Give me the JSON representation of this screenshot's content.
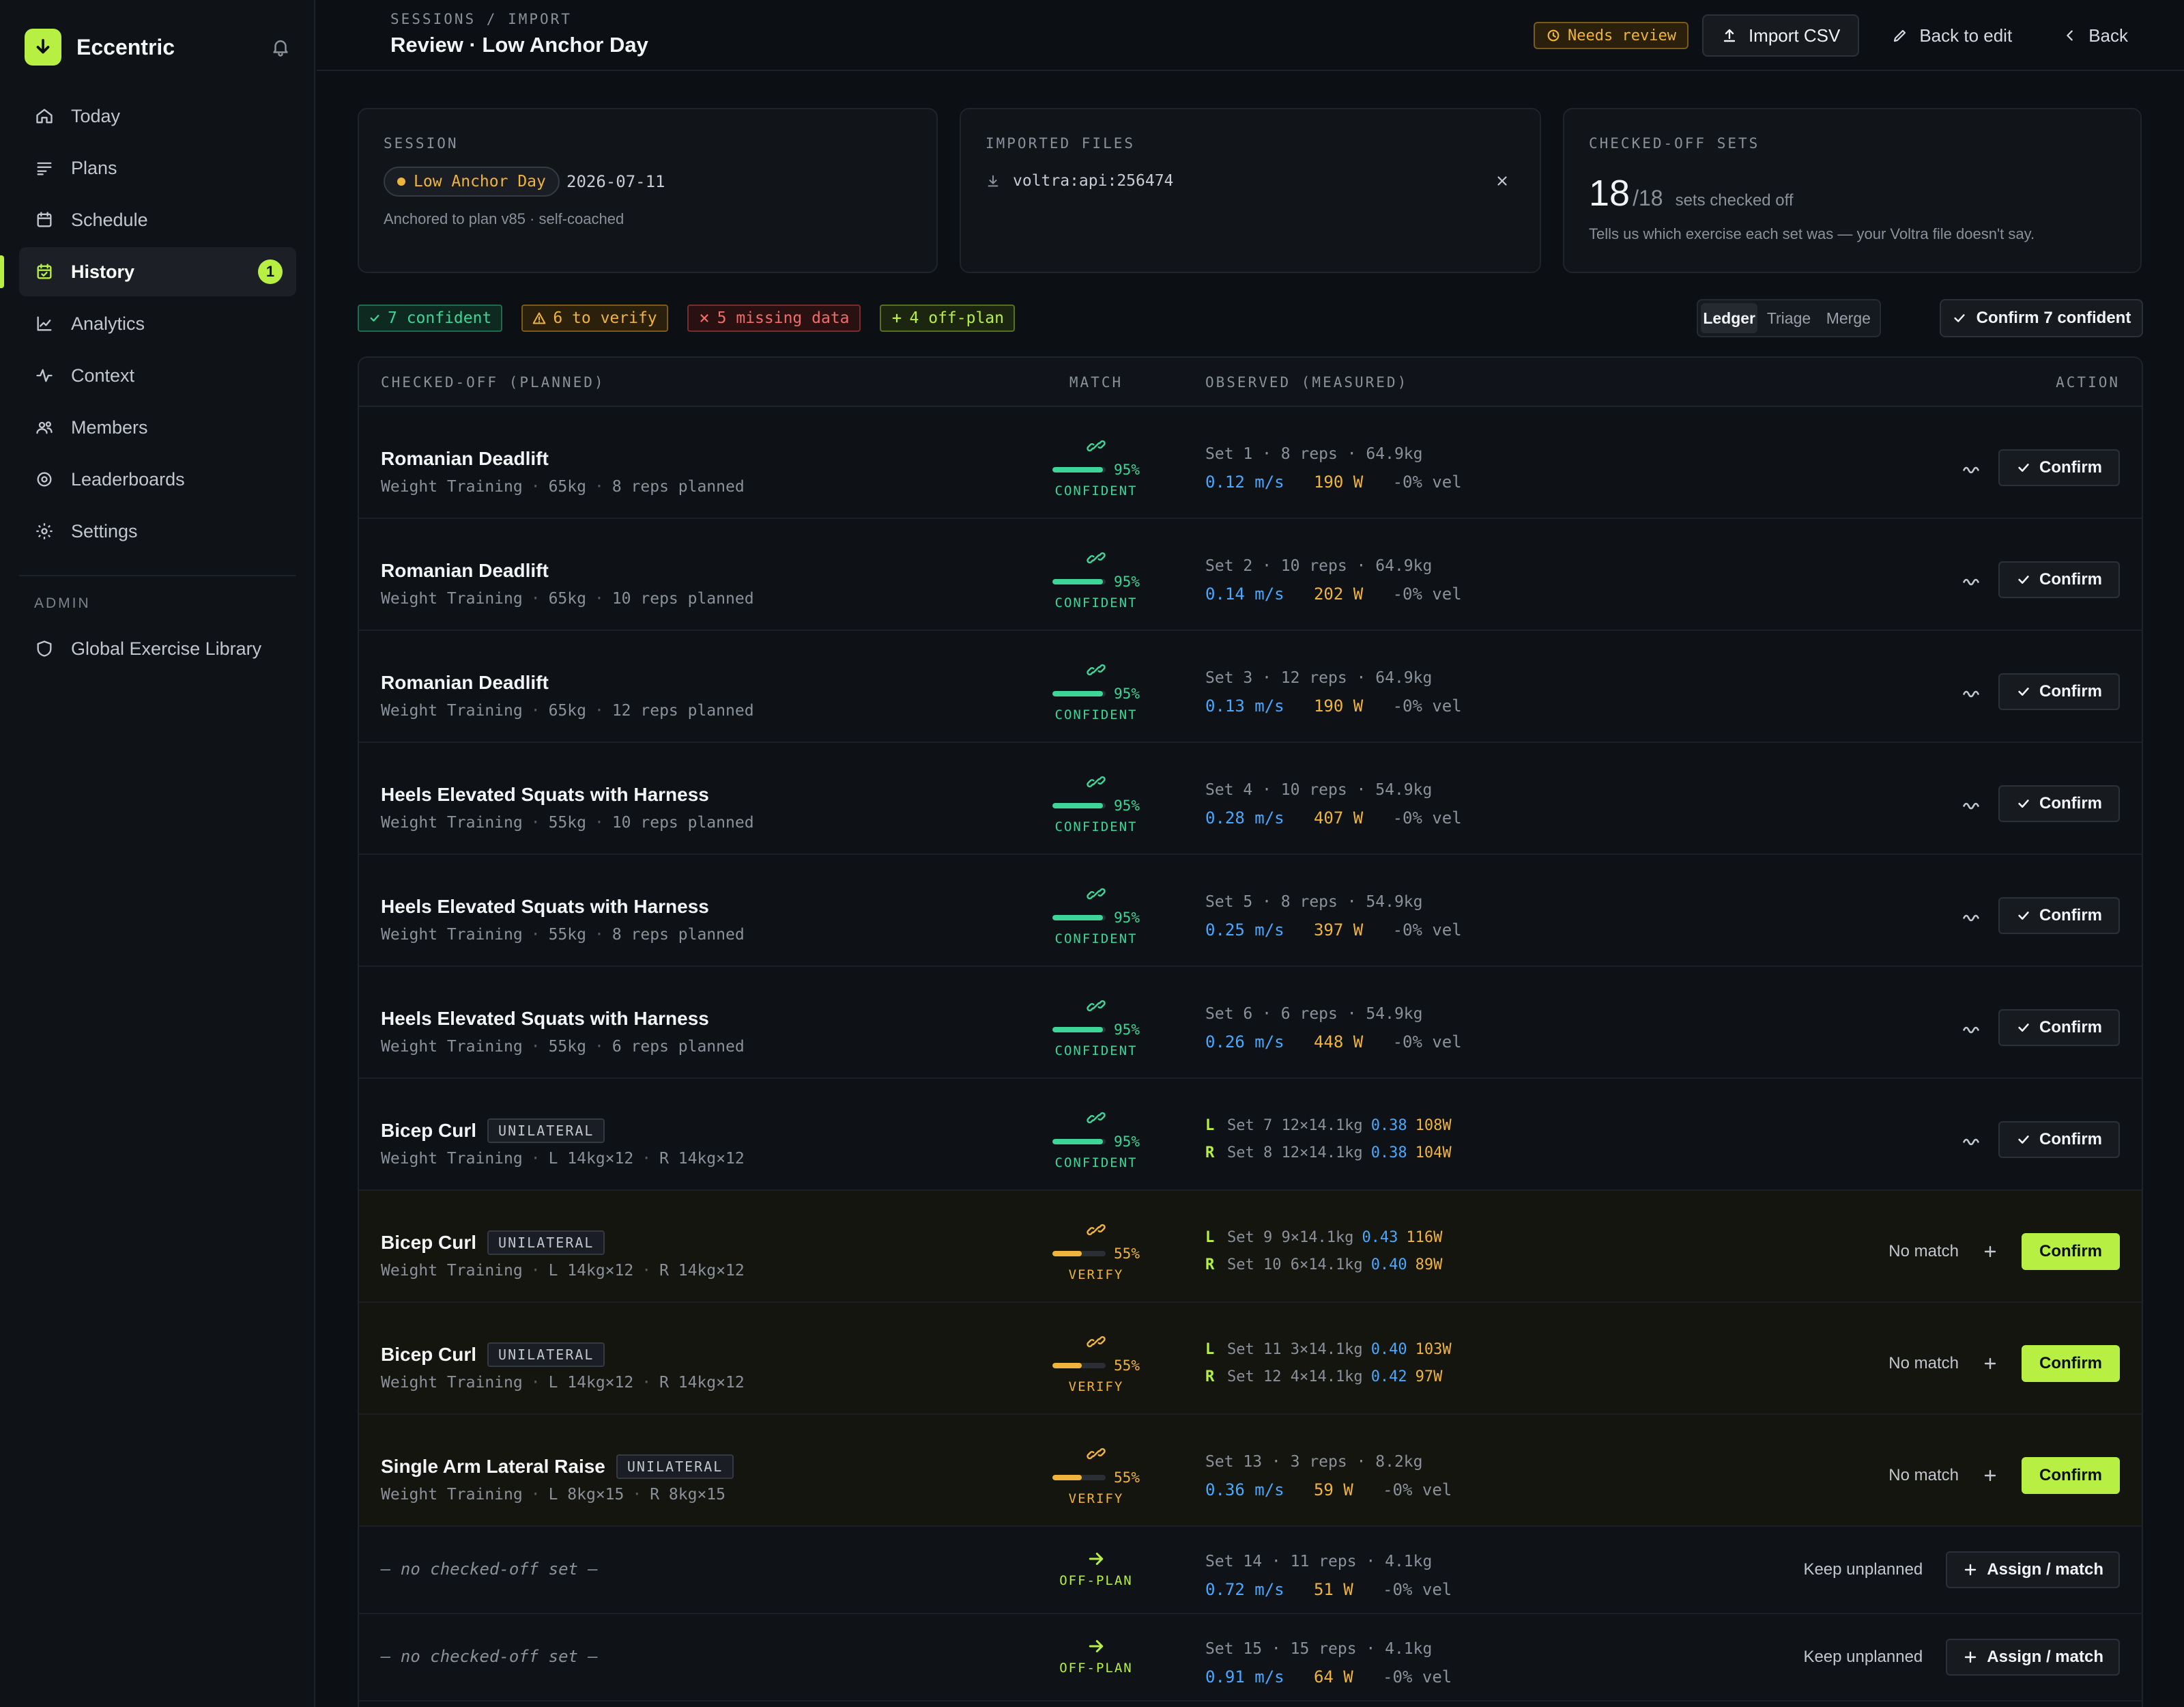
{
  "app": {
    "name": "Eccentric",
    "notification_badge": "1"
  },
  "sidebar": {
    "items": [
      {
        "label": "Today",
        "icon": "home-icon"
      },
      {
        "label": "Plans",
        "icon": "list-icon"
      },
      {
        "label": "Schedule",
        "icon": "calendar-icon"
      },
      {
        "label": "History",
        "icon": "calendar-check-icon",
        "active": true,
        "badge": "1"
      },
      {
        "label": "Analytics",
        "icon": "line-chart-icon"
      },
      {
        "label": "Context",
        "icon": "pulse-icon"
      },
      {
        "label": "Members",
        "icon": "users-icon"
      },
      {
        "label": "Leaderboards",
        "icon": "target-icon"
      },
      {
        "label": "Settings",
        "icon": "gear-icon"
      }
    ],
    "admin_section": "ADMIN",
    "admin_items": [
      {
        "label": "Global Exercise Library",
        "icon": "shield-icon"
      }
    ]
  },
  "header": {
    "breadcrumb": "SESSIONS / IMPORT",
    "title": "Review · Low Anchor Day",
    "needs_review": "Needs review",
    "import_csv": "Import CSV",
    "back_to_edit": "Back to edit",
    "back": "Back"
  },
  "cards": {
    "session": {
      "label": "SESSION",
      "name": "Low Anchor Day",
      "date": "2026-07-11",
      "sub": "Anchored to plan v85 · self-coached"
    },
    "files": {
      "label": "IMPORTED FILES",
      "file": "voltra:api:256474"
    },
    "sets": {
      "label": "CHECKED-OFF SETS",
      "count": "18",
      "total": "/18",
      "count_label": "sets checked off",
      "sub": "Tells us which exercise each set was — your Voltra file doesn't say."
    }
  },
  "filters": {
    "confident": "7 confident",
    "verify": "6 to verify",
    "missing": "5 missing data",
    "offplan": "4 off-plan"
  },
  "view_toggle": {
    "ledger": "Ledger",
    "triage": "Triage",
    "merge": "Merge"
  },
  "confirm_all": "Confirm 7 confident",
  "table": {
    "headers": {
      "planned": "CHECKED-OFF (PLANNED)",
      "match": "MATCH",
      "observed": "OBSERVED (MEASURED)",
      "action": "ACTION"
    },
    "labels": {
      "confirm": "Confirm",
      "no_match": "No match",
      "keep_unplanned": "Keep unplanned",
      "assign": "Assign / match",
      "no_set": "— no checked-off set —"
    },
    "rows": [
      {
        "title": "Romanian Deadlift",
        "meta": [
          "Weight Training",
          "65kg",
          "8 reps planned"
        ],
        "pct": "95%",
        "score": 0.95,
        "status": "CONFIDENT",
        "obs1": "Set 1 · 8 reps · 64.9kg",
        "vel": "0.12 m/s",
        "watts": "190 W",
        "drop": "-0% vel"
      },
      {
        "title": "Romanian Deadlift",
        "meta": [
          "Weight Training",
          "65kg",
          "10 reps planned"
        ],
        "pct": "95%",
        "score": 0.95,
        "status": "CONFIDENT",
        "obs1": "Set 2 · 10 reps · 64.9kg",
        "vel": "0.14 m/s",
        "watts": "202 W",
        "drop": "-0% vel"
      },
      {
        "title": "Romanian Deadlift",
        "meta": [
          "Weight Training",
          "65kg",
          "12 reps planned"
        ],
        "pct": "95%",
        "score": 0.95,
        "status": "CONFIDENT",
        "obs1": "Set 3 · 12 reps · 64.9kg",
        "vel": "0.13 m/s",
        "watts": "190 W",
        "drop": "-0% vel"
      },
      {
        "title": "Heels Elevated Squats with Harness",
        "meta": [
          "Weight Training",
          "55kg",
          "10 reps planned"
        ],
        "pct": "95%",
        "score": 0.95,
        "status": "CONFIDENT",
        "obs1": "Set 4 · 10 reps · 54.9kg",
        "vel": "0.28 m/s",
        "watts": "407 W",
        "drop": "-0% vel"
      },
      {
        "title": "Heels Elevated Squats with Harness",
        "meta": [
          "Weight Training",
          "55kg",
          "8 reps planned"
        ],
        "pct": "95%",
        "score": 0.95,
        "status": "CONFIDENT",
        "obs1": "Set 5 · 8 reps · 54.9kg",
        "vel": "0.25 m/s",
        "watts": "397 W",
        "drop": "-0% vel"
      },
      {
        "title": "Heels Elevated Squats with Harness",
        "meta": [
          "Weight Training",
          "55kg",
          "6 reps planned"
        ],
        "pct": "95%",
        "score": 0.95,
        "status": "CONFIDENT",
        "obs1": "Set 6 · 6 reps · 54.9kg",
        "vel": "0.26 m/s",
        "watts": "448 W",
        "drop": "-0% vel"
      },
      {
        "title": "Bicep Curl",
        "tag": "UNILATERAL",
        "meta": [
          "Weight Training",
          "L 14kg×12",
          "R 14kg×12"
        ],
        "pct": "95%",
        "score": 0.95,
        "status": "CONFIDENT",
        "left": {
          "side": "L",
          "set": "Set 7 12×14.1kg",
          "vel": "0.38",
          "watts": "108W"
        },
        "right": {
          "side": "R",
          "set": "Set 8 12×14.1kg",
          "vel": "0.38",
          "watts": "104W"
        }
      },
      {
        "title": "Bicep Curl",
        "tag": "UNILATERAL",
        "meta": [
          "Weight Training",
          "L 14kg×12",
          "R 14kg×12"
        ],
        "pct": "55%",
        "score": 0.55,
        "status": "VERIFY",
        "left": {
          "side": "L",
          "set": "Set 9 9×14.1kg",
          "vel": "0.43",
          "watts": "116W"
        },
        "right": {
          "side": "R",
          "set": "Set 10 6×14.1kg",
          "vel": "0.40",
          "watts": "89W"
        }
      },
      {
        "title": "Bicep Curl",
        "tag": "UNILATERAL",
        "meta": [
          "Weight Training",
          "L 14kg×12",
          "R 14kg×12"
        ],
        "pct": "55%",
        "score": 0.55,
        "status": "VERIFY",
        "left": {
          "side": "L",
          "set": "Set 11 3×14.1kg",
          "vel": "0.40",
          "watts": "103W"
        },
        "right": {
          "side": "R",
          "set": "Set 12 4×14.1kg",
          "vel": "0.42",
          "watts": "97W"
        }
      },
      {
        "title": "Single Arm Lateral Raise",
        "tag": "UNILATERAL",
        "meta": [
          "Weight Training",
          "L 8kg×15",
          "R 8kg×15"
        ],
        "pct": "55%",
        "score": 0.55,
        "status": "VERIFY",
        "obs1": "Set 13 · 3 reps · 8.2kg",
        "vel": "0.36 m/s",
        "watts": "59 W",
        "drop": "-0% vel"
      },
      {
        "status": "OFF-PLAN",
        "obs1": "Set 14 · 11 reps · 4.1kg",
        "vel": "0.72 m/s",
        "watts": "51 W",
        "drop": "-0% vel"
      },
      {
        "status": "OFF-PLAN",
        "obs1": "Set 15 · 15 reps · 4.1kg",
        "vel": "0.91 m/s",
        "watts": "64 W",
        "drop": "-0% vel"
      }
    ]
  },
  "colors": {
    "accent": "#b7f043",
    "confident": "#3dd598",
    "verify": "#f0b43c",
    "missing": "#f26b6b",
    "velocity": "#4aa8ff"
  }
}
